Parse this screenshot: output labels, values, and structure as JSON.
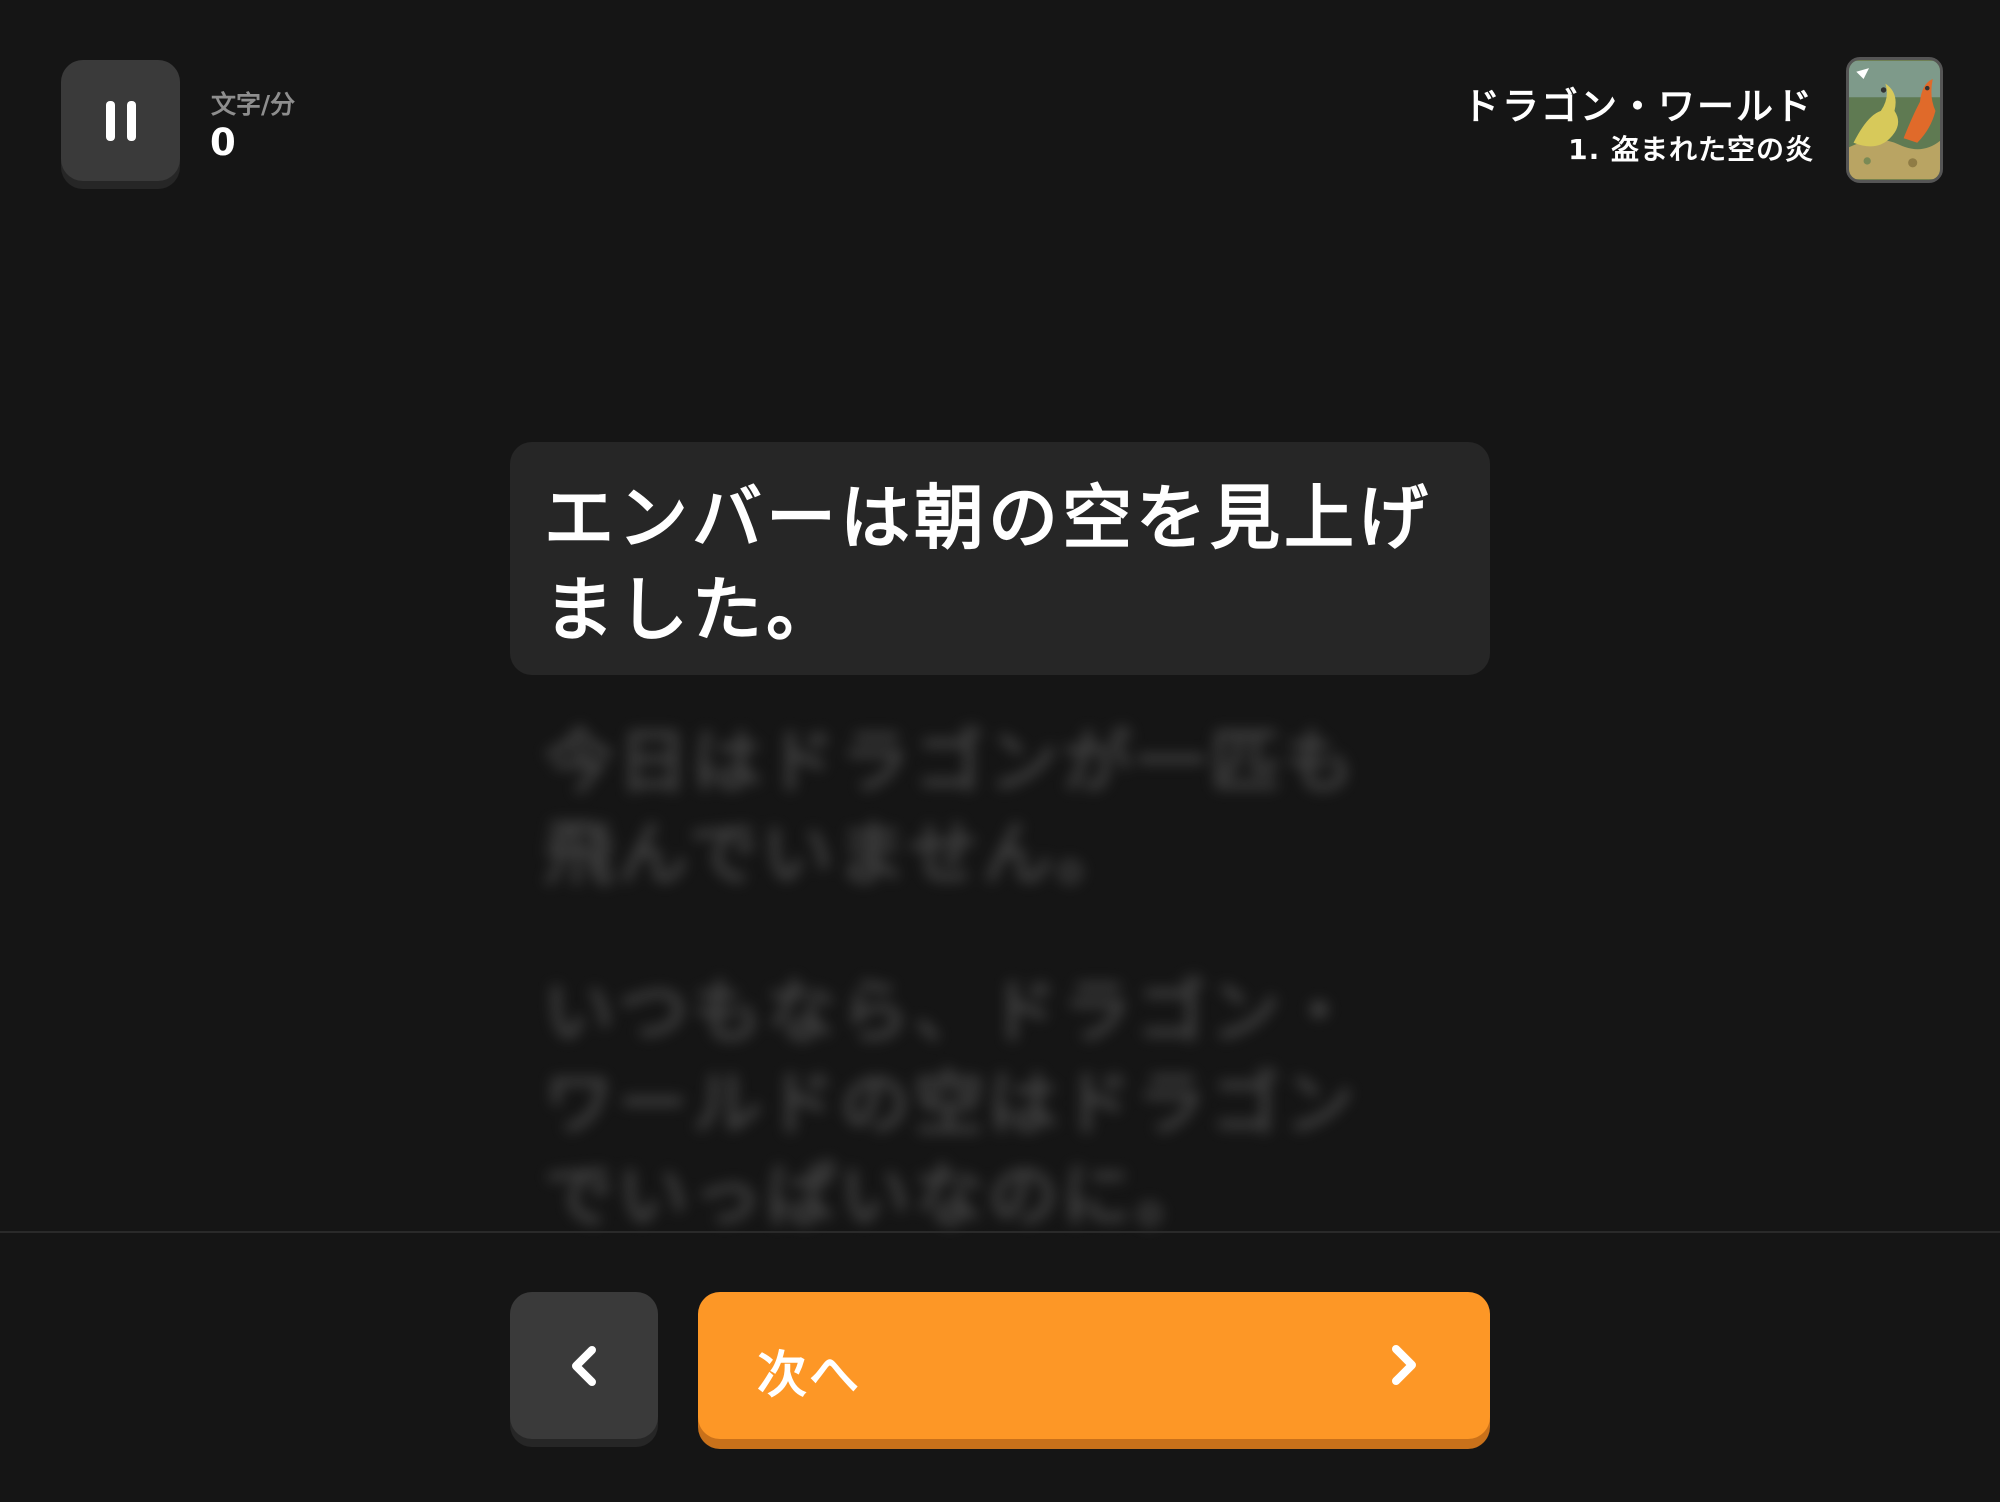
{
  "header": {
    "pause_icon": "pause-icon",
    "wpm_label": "文字/分",
    "wpm_value": "0",
    "book_title": "ドラゴン・ワールド",
    "chapter_title": "1. 盗まれた空の炎",
    "book_cover_icon": "dragon-cover-image"
  },
  "reader": {
    "current_sentence": "エンバーは朝の空を見上げました。",
    "next_sentences": [
      "今日はドラゴンが一匹も飛んでいません。",
      "いつもなら、ドラゴン・ワールドの空はドラゴンでいっぱいなのに。"
    ]
  },
  "footer": {
    "prev_icon": "chevron-left-icon",
    "next_label": "次へ",
    "next_icon": "chevron-right-icon"
  },
  "colors": {
    "background": "#151515",
    "card": "#262626",
    "button_dark": "#3a3a3a",
    "accent": "#fd9726",
    "accent_shadow": "#c9711a"
  }
}
